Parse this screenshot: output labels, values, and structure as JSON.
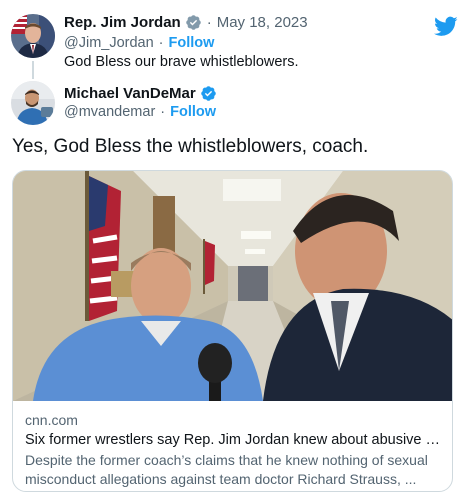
{
  "parent_tweet": {
    "name": "Rep. Jim Jordan",
    "handle": "@Jim_Jordan",
    "date": "May 18, 2023",
    "follow_label": "Follow",
    "separator": "·",
    "text": "God Bless our brave whistleblowers.",
    "verified_icon": "gray-verified-badge-icon",
    "avatar_icon": "avatar-photo-jim-jordan"
  },
  "reply_tweet": {
    "name": "Michael VanDeMar",
    "handle": "@mvandemar",
    "follow_label": "Follow",
    "separator": "·",
    "text": "Yes, God Bless the whistleblowers, coach.",
    "verified_icon": "blue-verified-badge-icon",
    "avatar_icon": "avatar-photo-michael-vandemar"
  },
  "link_card": {
    "domain": "cnn.com",
    "title": "Six former wrestlers say Rep. Jim Jordan knew about abusive OS...",
    "description": "Despite the former coach’s claims that he knew nothing of sexual misconduct allegations against team doctor Richard Strauss, ...",
    "image_icon": "news-photo-hallway-interview"
  },
  "icons": {
    "brand": "twitter-bird-icon"
  },
  "colors": {
    "accent": "#1d9bf0",
    "secondary_text": "#536471",
    "border": "#cfd9de",
    "verified_gray": "#829aab"
  }
}
